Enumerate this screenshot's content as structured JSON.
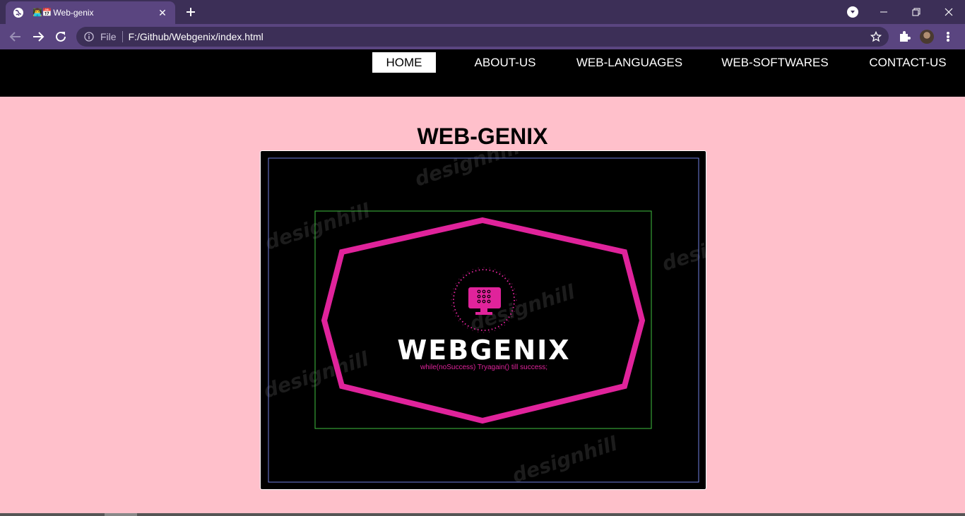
{
  "browser": {
    "tab": {
      "emoji": "👨‍💻📅",
      "title": "Web-genix"
    },
    "address": {
      "scheme": "File",
      "url": "F:/Github/Webgenix/index.html"
    }
  },
  "site": {
    "nav": [
      {
        "label": "HOME",
        "active": true
      },
      {
        "label": "ABOUT-US",
        "active": false
      },
      {
        "label": "WEB-LANGUAGES",
        "active": false
      },
      {
        "label": "WEB-SOFTWARES",
        "active": false
      },
      {
        "label": "CONTACT-US",
        "active": false
      }
    ],
    "heading": "WEB-GENIX",
    "banner": {
      "brand": "WEBGENIX",
      "tagline": "while(noSuccess) Tryagain() till success;",
      "watermark": "designhill"
    }
  },
  "colors": {
    "page_bg": "#ffc0cb",
    "nav_bg": "#000000",
    "brand_pink": "#e0239b",
    "frame_blue": "#6f7fe0",
    "frame_green": "#3fbf3f"
  }
}
